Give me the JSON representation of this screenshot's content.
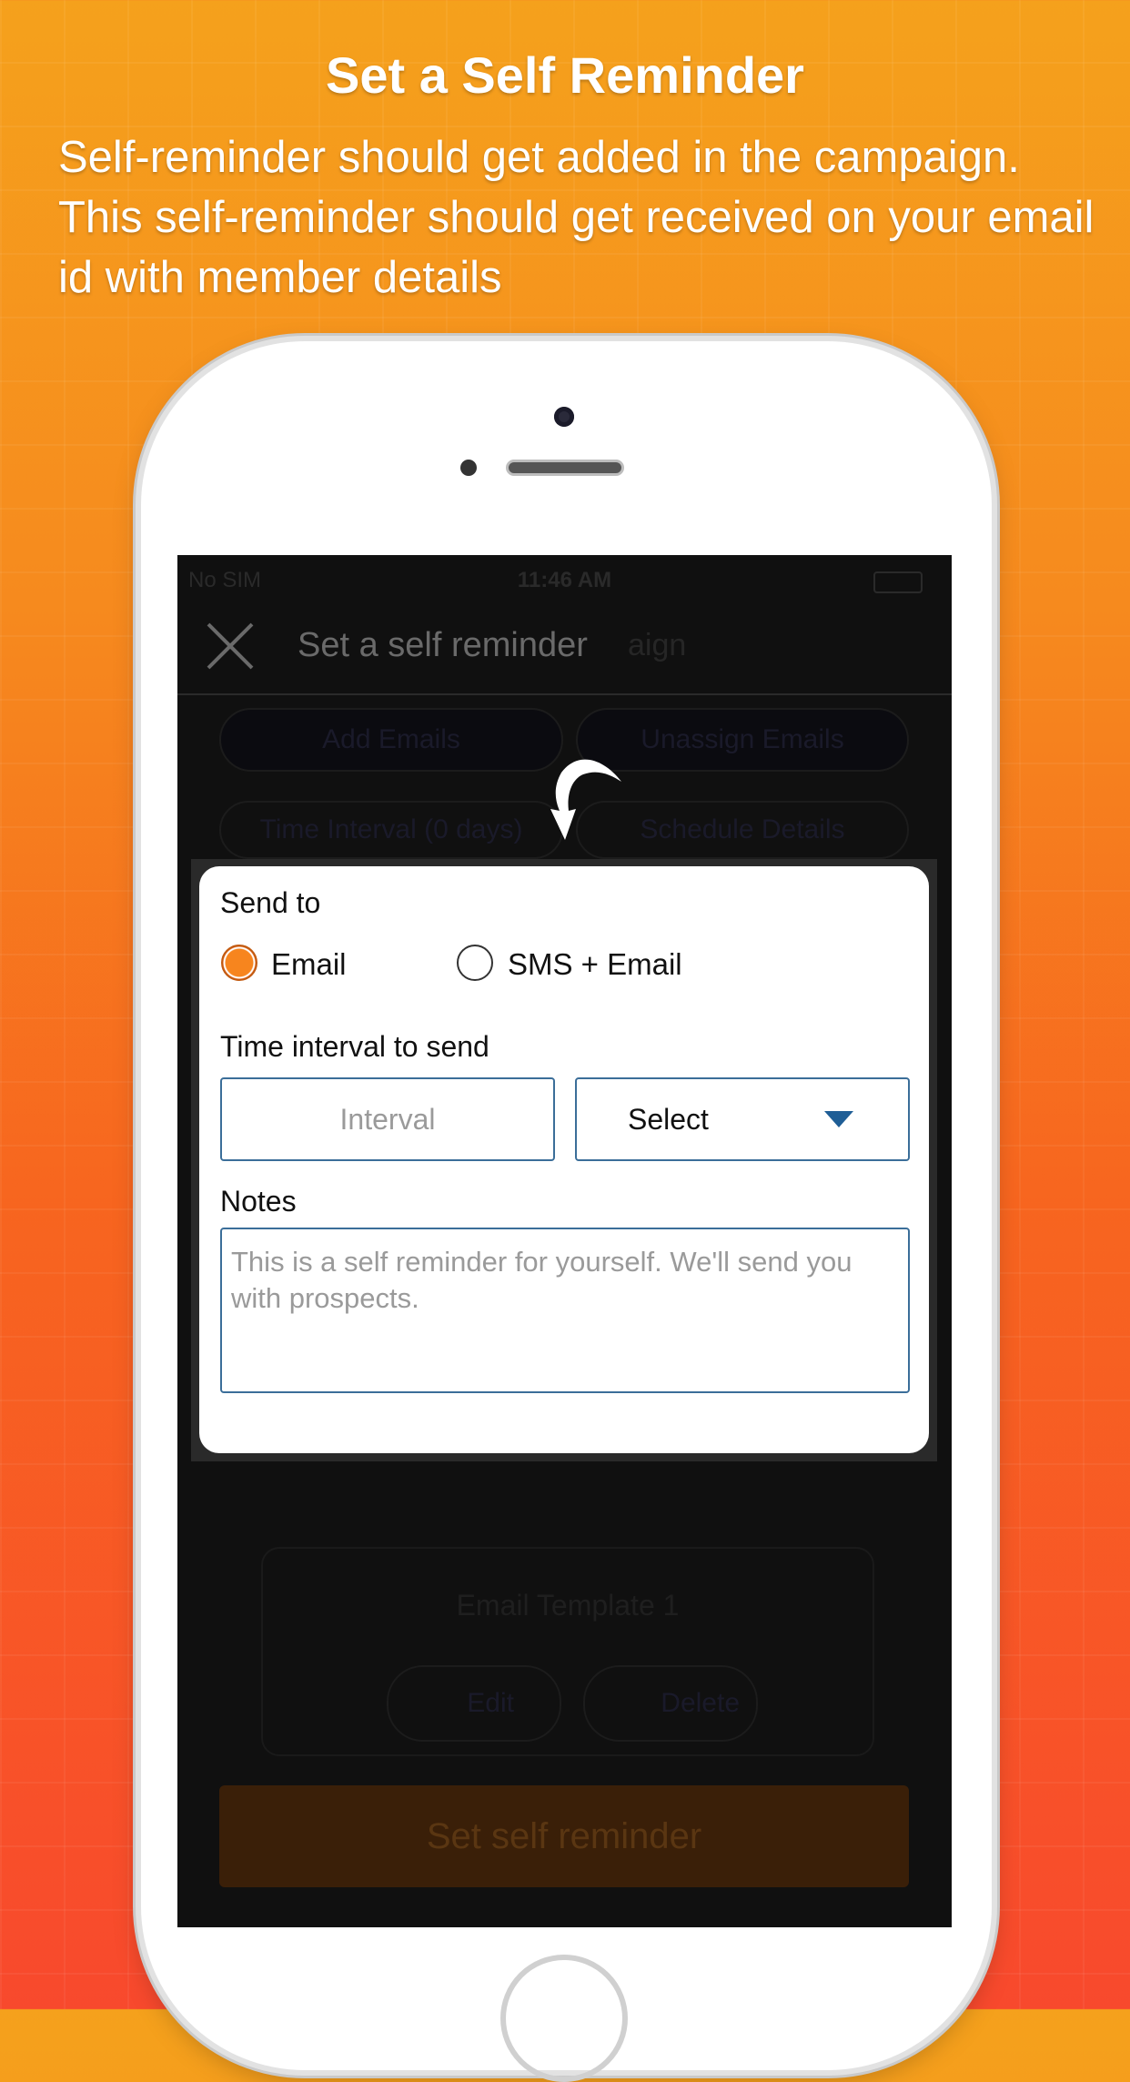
{
  "header": {
    "title": "Set a Self Reminder",
    "subtitle": "Self-reminder should get added in the campaign. This self-reminder should get received on your email id with member details"
  },
  "statusbar": {
    "carrier": "No SIM",
    "time": "11:46 AM"
  },
  "navbar": {
    "title": "Set a self reminder",
    "title_overlap": "aign"
  },
  "background_screen": {
    "add_emails": "Add Emails",
    "unassign_emails": "Unassign Emails",
    "time_interval": "Time Interval (0 days)",
    "schedule_details": "Schedule Details",
    "template_name": "Email Template 1",
    "edit": "Edit",
    "delete": "Delete",
    "set_reminder_button": "Set self reminder"
  },
  "dialog": {
    "send_to_label": "Send to",
    "options": [
      {
        "label": "Email",
        "selected": true
      },
      {
        "label": "SMS + Email",
        "selected": false
      }
    ],
    "time_interval_label": "Time interval to send",
    "interval_placeholder": "Interval",
    "unit_select_value": "Select",
    "notes_label": "Notes",
    "notes_placeholder": "This is a self reminder for yourself. We'll send you with prospects."
  },
  "colors": {
    "accent": "#f7851e",
    "field_border": "#3b6e99",
    "caret": "#1f5e96"
  }
}
